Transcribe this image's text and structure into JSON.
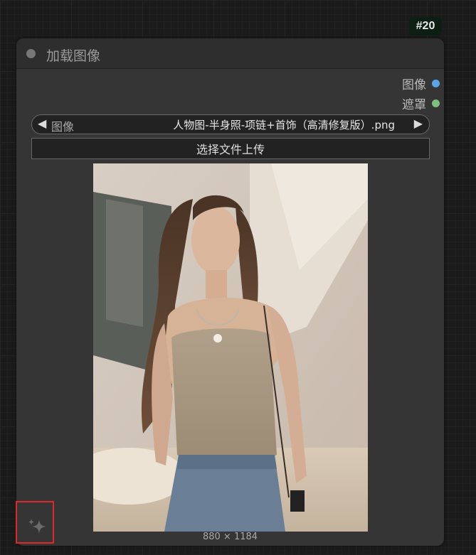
{
  "node": {
    "id_badge": "#20",
    "title": "加载图像",
    "outputs": [
      {
        "label": "图像",
        "color": "#5ba4e6"
      },
      {
        "label": "遮罩",
        "color": "#7dbf7d"
      }
    ],
    "combo": {
      "name": "图像",
      "value": "人物图-半身照-项链+首饰（高清修复版）.png",
      "prev_arrow": "◀",
      "next_arrow": "▶"
    },
    "upload_button_label": "选择文件上传",
    "image_size": "880 × 1184"
  },
  "icons": {
    "status": "status-dot-icon",
    "sparkle": "sparkle-icon"
  },
  "colors": {
    "highlight": "#e0282b",
    "node_bg": "#353535"
  }
}
